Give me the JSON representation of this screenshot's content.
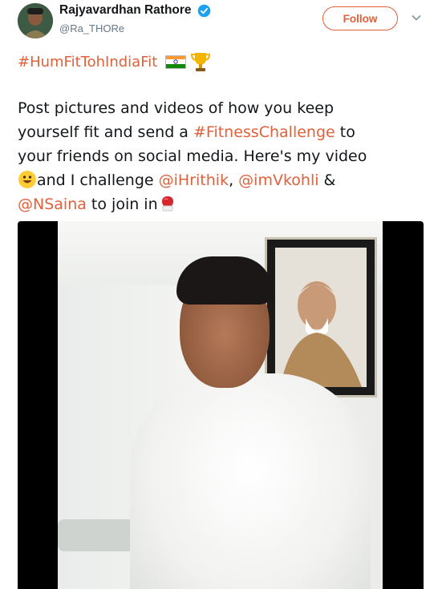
{
  "tweet": {
    "author_name": "Rajyavardhan Rathore",
    "author_handle": "@Ra_THORe",
    "follow_label": "Follow",
    "hashtag": "#HumFitTohIndiaFit",
    "text_lines": [
      {
        "parts": [
          {
            "t": "Post pictures and videos of how you keep"
          }
        ]
      },
      {
        "parts": [
          {
            "t": "yourself fit and send a "
          },
          {
            "t": "#FitnessChallenge",
            "link": true
          },
          {
            "t": " to"
          }
        ]
      },
      {
        "parts": [
          {
            "t": "your friends on social media. Here's my video"
          }
        ]
      },
      {
        "parts": [
          {
            "t": "and I challenge "
          },
          {
            "t": "@iHrithik",
            "link": true
          },
          {
            "t": ", "
          },
          {
            "t": "@imVkohli",
            "link": true
          },
          {
            "t": " &"
          }
        ]
      },
      {
        "parts": [
          {
            "t": "@NSaina",
            "link": true
          },
          {
            "t": " to join in"
          }
        ]
      }
    ],
    "accent_color": "#e0613a",
    "icons": [
      "verified-badge-icon",
      "chevron-down-icon",
      "india-flag-icon",
      "trophy-icon",
      "smiley-icon",
      "boxing-glove-icon"
    ]
  }
}
